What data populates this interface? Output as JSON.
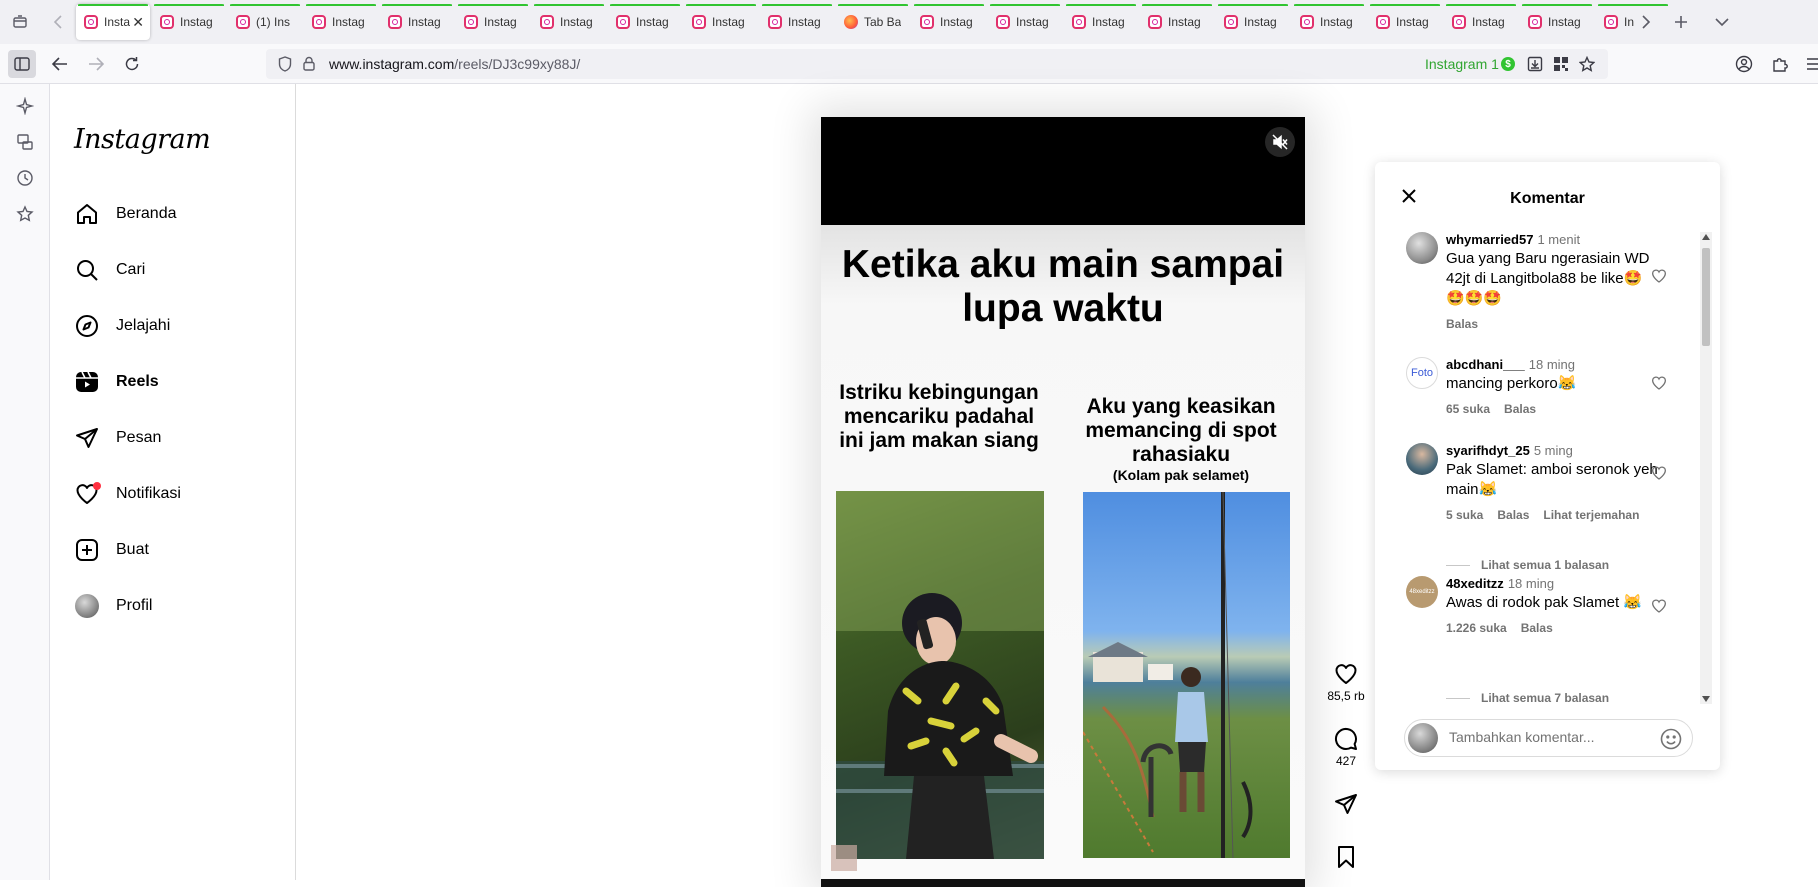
{
  "browser": {
    "tabs": [
      {
        "title": "Insta",
        "active": true,
        "icon": "instagram-icon"
      },
      {
        "title": "Instag",
        "icon": "instagram-icon"
      },
      {
        "title": "(1) Ins",
        "icon": "instagram-icon"
      },
      {
        "title": "Instag",
        "icon": "instagram-icon"
      },
      {
        "title": "Instag",
        "icon": "instagram-icon"
      },
      {
        "title": "Instag",
        "icon": "instagram-icon"
      },
      {
        "title": "Instag",
        "icon": "instagram-icon"
      },
      {
        "title": "Instag",
        "icon": "instagram-icon"
      },
      {
        "title": "Instag",
        "icon": "instagram-icon"
      },
      {
        "title": "Instag",
        "icon": "instagram-icon"
      },
      {
        "title": "Tab Ba",
        "icon": "firefox-icon"
      },
      {
        "title": "Instag",
        "icon": "instagram-icon"
      },
      {
        "title": "Instag",
        "icon": "instagram-icon"
      },
      {
        "title": "Instag",
        "icon": "instagram-icon"
      },
      {
        "title": "Instag",
        "icon": "instagram-icon"
      },
      {
        "title": "Instag",
        "icon": "instagram-icon"
      },
      {
        "title": "Instag",
        "icon": "instagram-icon"
      },
      {
        "title": "Instag",
        "icon": "instagram-icon"
      },
      {
        "title": "Instag",
        "icon": "instagram-icon"
      },
      {
        "title": "Instag",
        "icon": "instagram-icon"
      },
      {
        "title": "In",
        "icon": "instagram-icon"
      }
    ],
    "url_host": "www.instagram.com",
    "url_path": "/reels/DJ3c99xy88J/",
    "extension_label": "Instagram 1",
    "extension_badge": "$",
    "accent_color": "#31c431"
  },
  "ig_nav": {
    "logo": "Instagram",
    "items": [
      {
        "label": "Beranda",
        "icon": "home-icon"
      },
      {
        "label": "Cari",
        "icon": "search-icon"
      },
      {
        "label": "Jelajahi",
        "icon": "explore-icon"
      },
      {
        "label": "Reels",
        "icon": "reels-icon"
      },
      {
        "label": "Pesan",
        "icon": "send-icon"
      },
      {
        "label": "Notifikasi",
        "icon": "heart-icon"
      },
      {
        "label": "Buat",
        "icon": "create-icon"
      },
      {
        "label": "Profil",
        "icon": "avatar"
      }
    ]
  },
  "reel": {
    "title": "Ketika aku main sampai lupa waktu",
    "caption_left": "Istriku kebingungan mencariku padahal ini jam makan siang",
    "caption_right": "Aku yang keasikan memancing di spot rahasiaku",
    "caption_right_sub": "(Kolam pak selamet)",
    "likes": "85,5 rb",
    "comments_count": "427"
  },
  "comments_panel": {
    "title": "Komentar",
    "input_placeholder": "Tambahkan komentar...",
    "comments": [
      {
        "user": "whymarried57",
        "time": "1 menit",
        "text": "Gua yang Baru ngerasiain WD 42jt di Langitbola88 be like🤩🤩🤩🤩",
        "likes": "",
        "reply": "Balas",
        "extra": "",
        "avatar_text": ""
      },
      {
        "user": "abcdhani___",
        "time": "18 ming",
        "text": "mancing perkoro😹",
        "likes": "65 suka",
        "reply": "Balas",
        "extra": "",
        "avatar_text": "Foto"
      },
      {
        "user": "syarifhdyt_25",
        "time": "5 ming",
        "text": "Pak Slamet: amboi seronok yeh main😹",
        "likes": "5 suka",
        "reply": "Balas",
        "extra": "Lihat terjemahan",
        "avatar_text": ""
      },
      {
        "user": "48xeditzz",
        "time": "18 ming",
        "text": "Awas di rodok pak Slamet 😹",
        "likes": "1.226 suka",
        "reply": "Balas",
        "extra": "",
        "avatar_text": "48xeditzz"
      }
    ],
    "view_replies": [
      "Lihat semua 1 balasan",
      "Lihat semua 7 balasan"
    ]
  }
}
